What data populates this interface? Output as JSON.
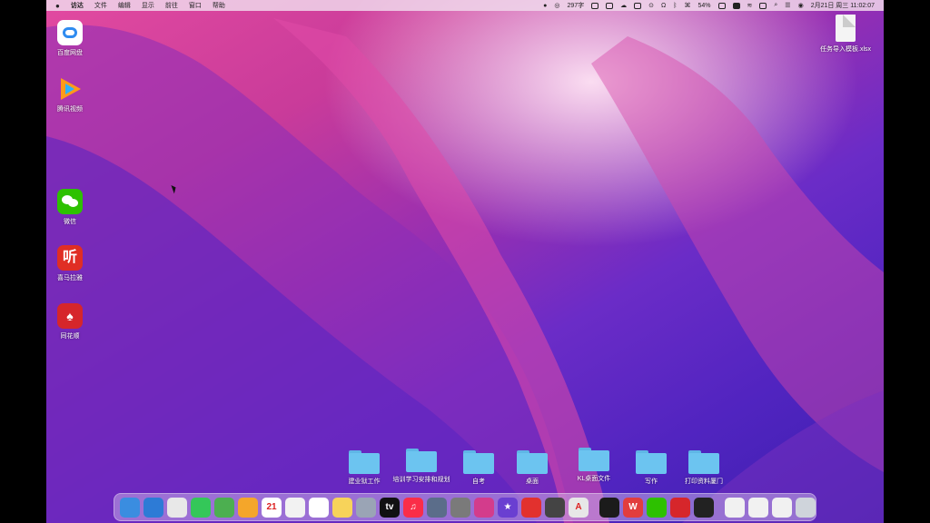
{
  "menubar": {
    "apple": "",
    "items": [
      "访达",
      "文件",
      "编辑",
      "显示",
      "前往",
      "窗口",
      "帮助"
    ],
    "status": {
      "wordcount": "297字",
      "battery": "54%",
      "datetime": "2月21日 周三 11:02:07"
    }
  },
  "desktop_icons": [
    {
      "label": "百度网盘",
      "icon": "baidu-netdisk-icon",
      "color": "#ffffff"
    },
    {
      "label": "腾讯视频",
      "icon": "tencent-video-icon",
      "color": "#ff8a00"
    },
    {
      "label": "微信",
      "icon": "wechat-icon",
      "color": "#2dc100"
    },
    {
      "label": "喜马拉雅",
      "icon": "ximalaya-icon",
      "color": "#e02e24"
    },
    {
      "label": "同花顺",
      "icon": "tonghuashun-icon",
      "color": "#d6262b"
    }
  ],
  "file": {
    "label": "任务导入模板.xlsx",
    "icon": "xlsx-file-icon"
  },
  "folders": [
    {
      "label": "建业狱工作"
    },
    {
      "label": "培训学习安排和规划"
    },
    {
      "label": "自考"
    },
    {
      "label": "桌面"
    },
    {
      "label": "KL桌面文件"
    },
    {
      "label": "写作"
    },
    {
      "label": "打印资料厦门"
    }
  ],
  "dock_apps": [
    {
      "name": "finder",
      "color": "#3a8de0",
      "glyph": ""
    },
    {
      "name": "safari",
      "color": "#2d7bd6",
      "glyph": ""
    },
    {
      "name": "chrome",
      "color": "#e8e8e8",
      "glyph": ""
    },
    {
      "name": "messages",
      "color": "#34c759",
      "glyph": ""
    },
    {
      "name": "maps",
      "color": "#4caf50",
      "glyph": ""
    },
    {
      "name": "photos",
      "color": "#f4a62a",
      "glyph": ""
    },
    {
      "name": "calendar",
      "color": "#ffffff",
      "glyph": "21"
    },
    {
      "name": "freeform",
      "color": "#f2f2f2",
      "glyph": ""
    },
    {
      "name": "reminders",
      "color": "#ffffff",
      "glyph": ""
    },
    {
      "name": "notes",
      "color": "#f7d35a",
      "glyph": ""
    },
    {
      "name": "launchpad",
      "color": "#9aa4b5",
      "glyph": ""
    },
    {
      "name": "apple-tv",
      "color": "#111111",
      "glyph": "tv"
    },
    {
      "name": "music",
      "color": "#fa2d48",
      "glyph": "♫"
    },
    {
      "name": "app-preview",
      "color": "#5b6d8a",
      "glyph": ""
    },
    {
      "name": "system-settings",
      "color": "#7a7a7a",
      "glyph": ""
    },
    {
      "name": "app-magenta",
      "color": "#d33c8c",
      "glyph": ""
    },
    {
      "name": "imovie",
      "color": "#6a3fd1",
      "glyph": "★"
    },
    {
      "name": "app-red",
      "color": "#e2312e",
      "glyph": ""
    },
    {
      "name": "screenshot",
      "color": "#444444",
      "glyph": ""
    },
    {
      "name": "autocad",
      "color": "#e7e7e7",
      "glyph": "A"
    },
    {
      "name": "terminal",
      "color": "#1b1b1b",
      "glyph": ""
    },
    {
      "name": "wps",
      "color": "#e23d3d",
      "glyph": "W"
    },
    {
      "name": "wechat",
      "color": "#2dc100",
      "glyph": ""
    },
    {
      "name": "tonghuashun",
      "color": "#d6262b",
      "glyph": ""
    },
    {
      "name": "zoom-video",
      "color": "#222222",
      "glyph": ""
    },
    {
      "name": "doc-thumb-1",
      "color": "#f1f1f1",
      "glyph": ""
    },
    {
      "name": "doc-thumb-2",
      "color": "#f1f1f1",
      "glyph": ""
    },
    {
      "name": "doc-thumb-3",
      "color": "#f1f1f1",
      "glyph": ""
    },
    {
      "name": "trash",
      "color": "#cfd4db",
      "glyph": ""
    }
  ]
}
